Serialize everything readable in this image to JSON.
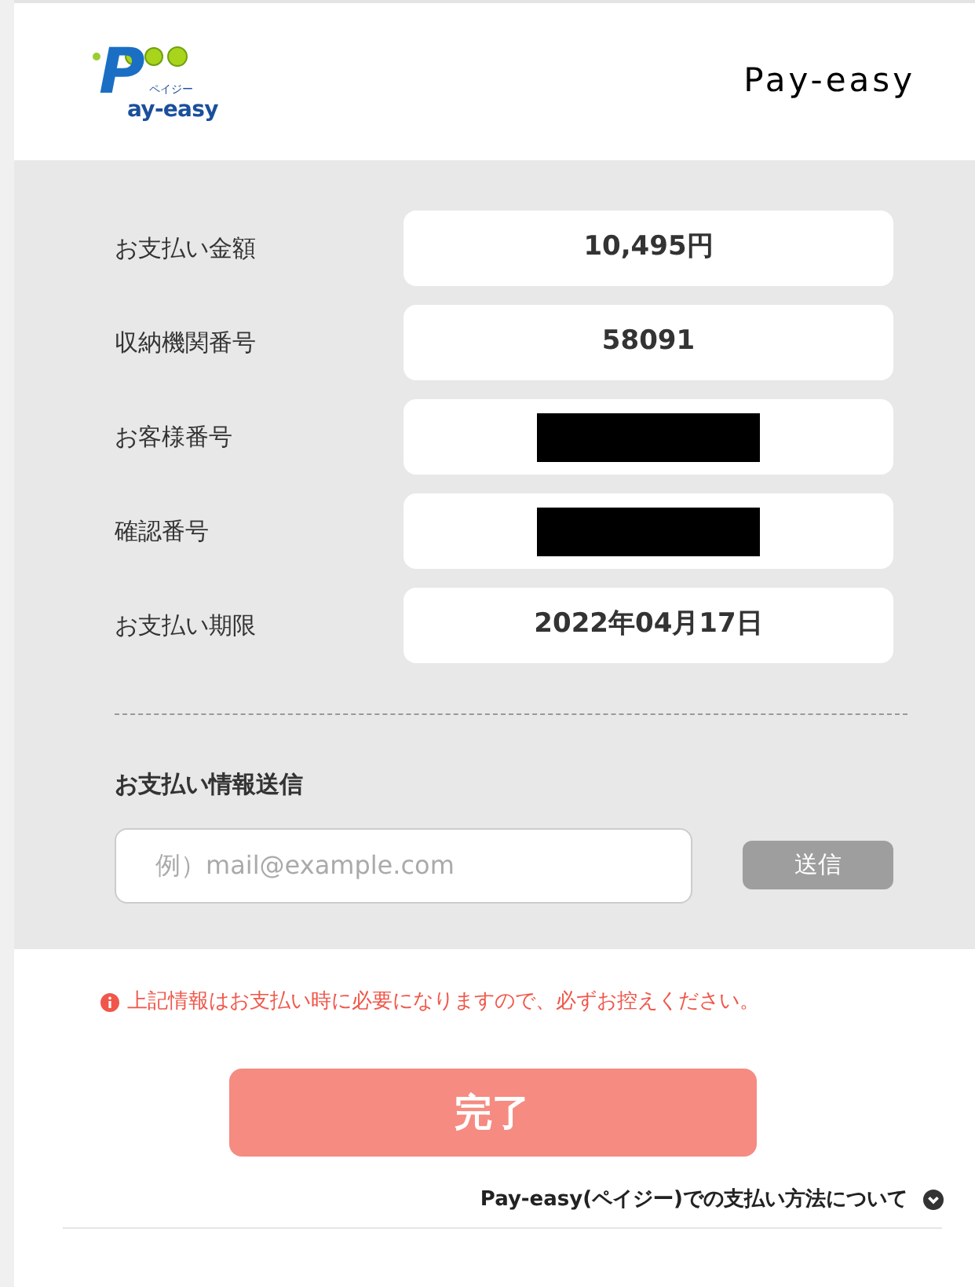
{
  "logo": {
    "mark": "P",
    "text": "ay-easy",
    "ruby": "ペイジー"
  },
  "header_title": "Pay-easy",
  "fields": [
    {
      "label": "お支払い金額",
      "kind": "text",
      "value": "10,495円"
    },
    {
      "label": "収納機関番号",
      "kind": "text",
      "value": "58091"
    },
    {
      "label": "お客様番号",
      "kind": "redacted"
    },
    {
      "label": "確認番号",
      "kind": "redacted"
    },
    {
      "label": "お支払い期限",
      "kind": "text",
      "value": "2022年04月17日"
    }
  ],
  "send_section": {
    "heading": "お支払い情報送信",
    "email_placeholder": "例）mail@example.com",
    "send_button": "送信",
    "send_disabled": true
  },
  "notice": "上記情報はお支払い時に必要になりますので、必ずお控えください。",
  "complete_button": "完了",
  "help_link": {
    "label": "Pay-easy(ペイジー)での支払い方法について",
    "expanded": false
  }
}
